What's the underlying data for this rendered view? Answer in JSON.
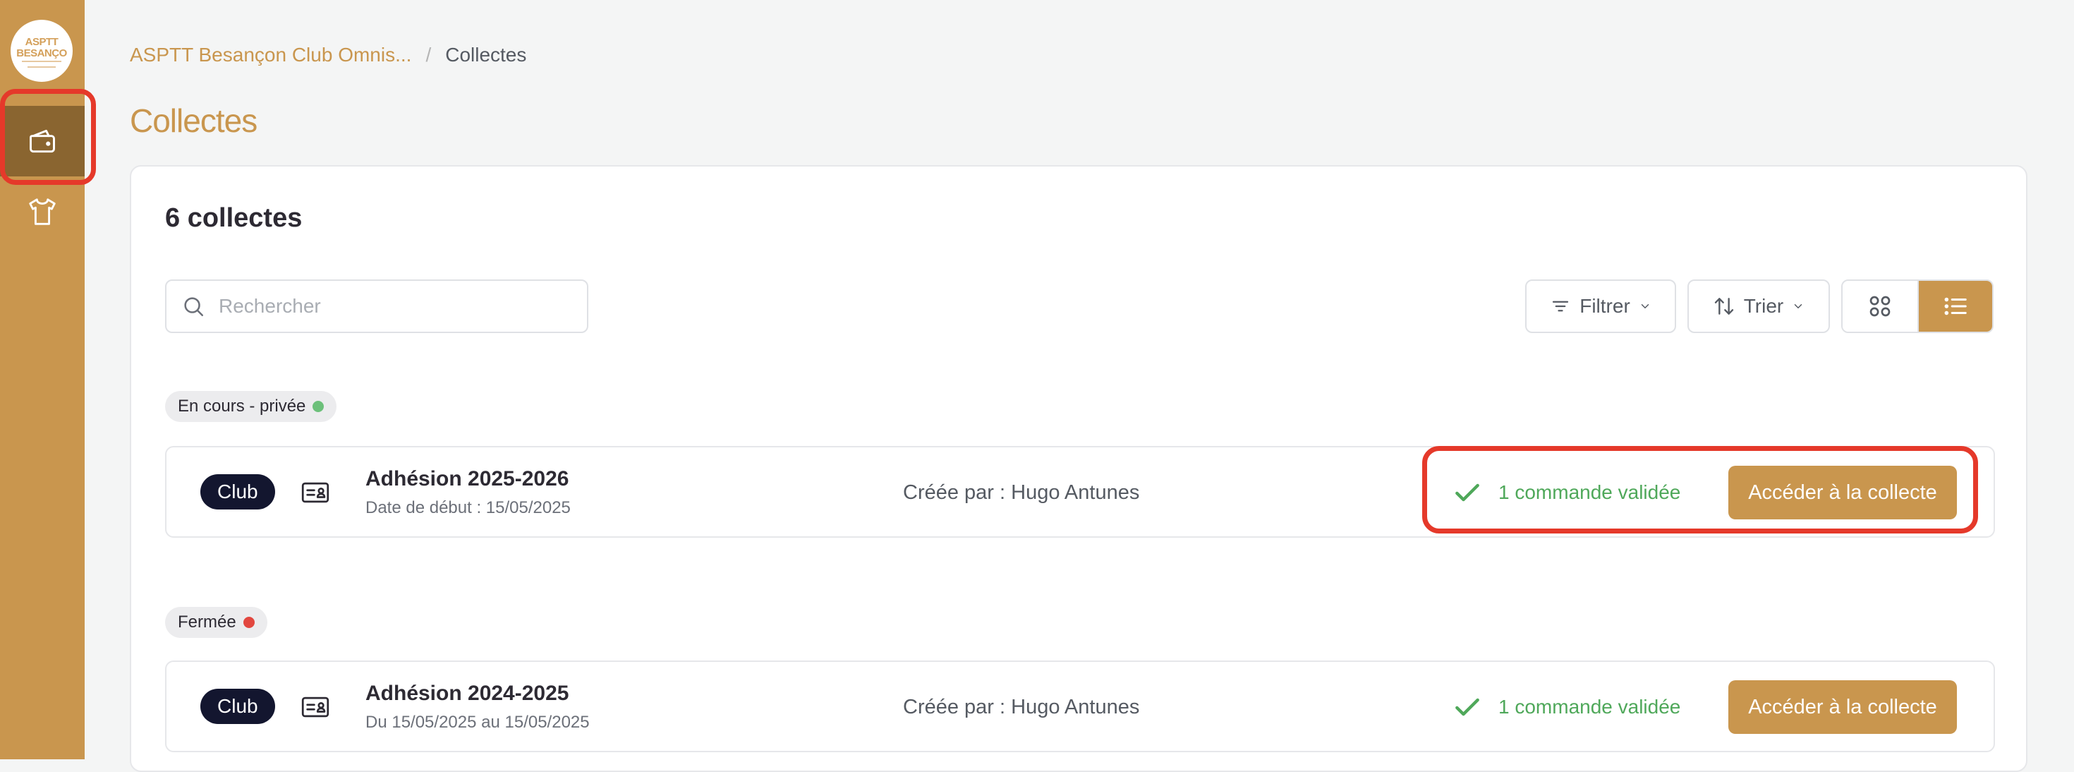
{
  "sidebar": {
    "logo_text": "ASPTT BESANÇO",
    "items": [
      {
        "icon": "wallet-icon",
        "active": true
      },
      {
        "icon": "tshirt-icon",
        "active": false
      }
    ]
  },
  "breadcrumb": {
    "org": "ASPTT Besançon Club Omnis...",
    "separator": "/",
    "current": "Collectes"
  },
  "page": {
    "title": "Collectes"
  },
  "toolbar": {
    "count": "6 collectes",
    "search_placeholder": "Rechercher",
    "filter_label": "Filtrer",
    "sort_label": "Trier",
    "view_mode": "list"
  },
  "groups": [
    {
      "status": "En cours - privée",
      "status_color": "#6cc07a",
      "collectes": [
        {
          "tag": "Club",
          "title": "Adhésion 2025-2026",
          "subtitle": "Date de début : 15/05/2025",
          "creator": "Créée par : Hugo Antunes",
          "validated": "1 commande validée",
          "cta": "Accéder à la collecte"
        }
      ]
    },
    {
      "status": "Fermée",
      "status_color": "#e2473f",
      "collectes": [
        {
          "tag": "Club",
          "title": "Adhésion 2024-2025",
          "subtitle": "Du 15/05/2025 au 15/05/2025",
          "creator": "Créée par : Hugo Antunes",
          "validated": "1 commande validée",
          "cta": "Accéder à la collecte"
        }
      ]
    }
  ],
  "colors": {
    "brand": "#c9964e",
    "brand_dark": "#8a6530",
    "tag_bg": "#13162f",
    "success": "#4fa85a",
    "highlight": "#e5392a"
  }
}
